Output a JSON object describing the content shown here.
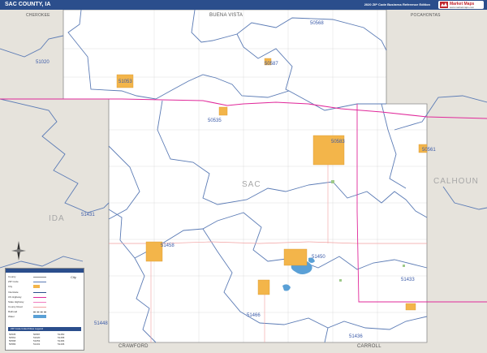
{
  "header": {
    "title": "SAC COUNTY, IA",
    "edition": "2020 ZIP Code Business Reference Edition",
    "brand": "Market Maps",
    "brand_sub": "www.marketmaps.com"
  },
  "neighbors": {
    "top_left": "CHEROKEE",
    "top_center": "BUENA VISTA",
    "top_right": "POCAHONTAS",
    "right": "CALHOUN",
    "left": "IDA",
    "bottom_center": "CRAWFORD",
    "bottom_right": "CARROLL",
    "center": "SAC"
  },
  "zip_codes": [
    {
      "id": "50568",
      "label": "50568"
    },
    {
      "id": "51020",
      "label": "51020"
    },
    {
      "id": "50587",
      "label": "50587"
    },
    {
      "id": "51053",
      "label": "51053"
    },
    {
      "id": "50535",
      "label": "50535"
    },
    {
      "id": "50583",
      "label": "50583"
    },
    {
      "id": "50561",
      "label": "50561"
    },
    {
      "id": "51431",
      "label": "51431"
    },
    {
      "id": "51458",
      "label": "51458"
    },
    {
      "id": "51450",
      "label": "51450"
    },
    {
      "id": "51433",
      "label": "51433"
    },
    {
      "id": "51466",
      "label": "51466"
    },
    {
      "id": "51448",
      "label": "51448"
    },
    {
      "id": "51436",
      "label": "51436"
    }
  ],
  "legend": {
    "rows": [
      "County",
      "ZIP Code",
      "City",
      "Interstate",
      "US Highway",
      "State Highway",
      "County Road",
      "Railroad",
      "Water"
    ],
    "city_label": "City",
    "table_title": "ZIP Code Index/Cities Legend",
    "accent": "#2b4e8c"
  },
  "colors": {
    "title_bar": "#2b4e8c",
    "neighbor_fill": "#e6e3dc",
    "county_fill": "#ffffff",
    "zip_boundary": "#5b7bb5",
    "city_fill": "#f3b54a",
    "highway": "#e0289a",
    "road": "#f2a0a0",
    "water": "#5aa0d6"
  },
  "icons": [
    "compass-icon",
    "market-maps-logo-icon"
  ]
}
